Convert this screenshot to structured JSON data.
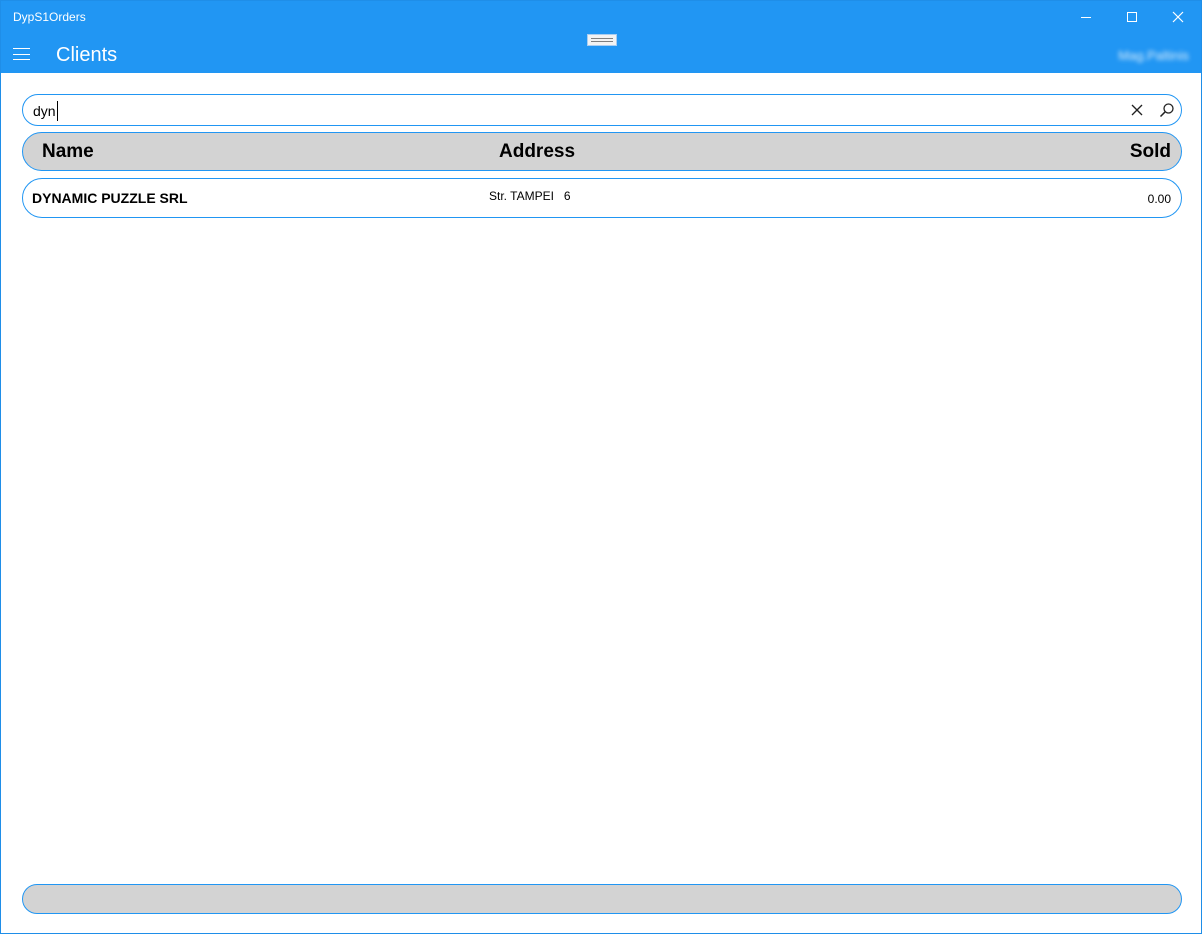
{
  "window": {
    "title": "DypS1Orders"
  },
  "header": {
    "page_title": "Clients",
    "user_name": "Mag.Paltinis"
  },
  "search": {
    "value": "dyn"
  },
  "table": {
    "columns": {
      "name": "Name",
      "address": "Address",
      "sold": "Sold"
    },
    "rows": [
      {
        "name": "DYNAMIC PUZZLE SRL",
        "address": "Str. TAMPEI   6",
        "sold": "0.00"
      }
    ]
  },
  "colors": {
    "accent": "#2196f3",
    "header_bg": "#d3d3d3"
  },
  "icons": {
    "menu": "hamburger-menu-icon",
    "clear": "close-icon",
    "search": "search-icon",
    "minimize": "minimize-icon",
    "maximize": "maximize-icon",
    "close": "close-icon"
  }
}
